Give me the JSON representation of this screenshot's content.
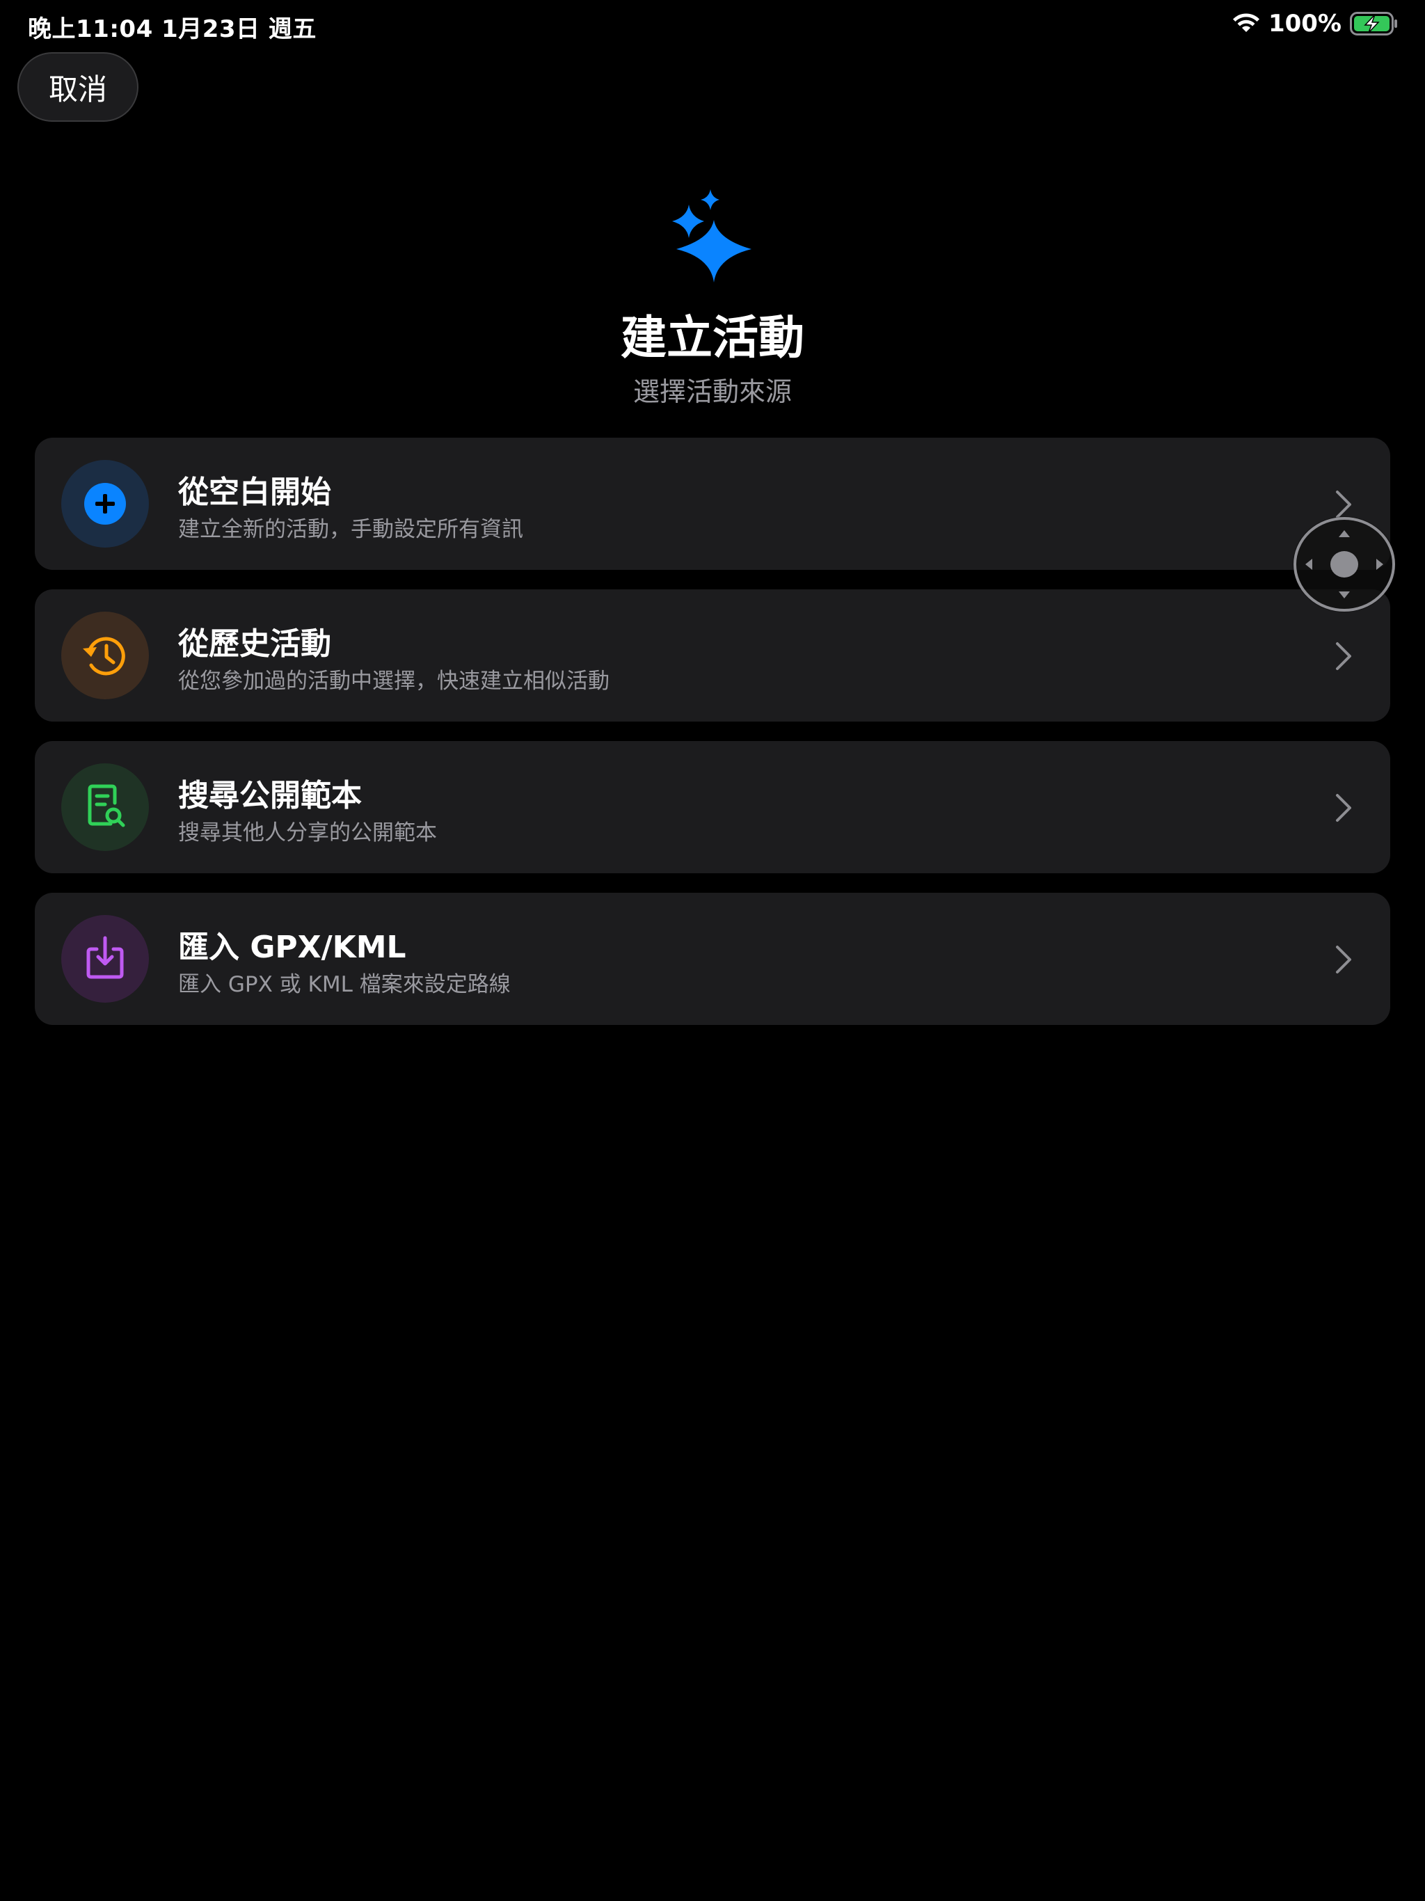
{
  "status_bar": {
    "time_date": "晚上11:04   1月23日 週五",
    "battery_percent": "100%",
    "battery_level": 1.0,
    "battery_color": "#34c759"
  },
  "header": {
    "cancel_label": "取消",
    "icon": "sparkles-icon",
    "icon_color": "#0a84ff",
    "title": "建立活動",
    "subtitle": "選擇活動來源"
  },
  "options": [
    {
      "title": "從空白開始",
      "description": "建立全新的活動，手動設定所有資訊",
      "icon": "plus-circle-icon",
      "accent": "#0a84ff"
    },
    {
      "title": "從歷史活動",
      "description": "從您參加過的活動中選擇，快速建立相似活動",
      "icon": "history-clock-icon",
      "accent": "#ff9f0a"
    },
    {
      "title": "搜尋公開範本",
      "description": "搜尋其他人分享的公開範本",
      "icon": "document-search-icon",
      "accent": "#30d158"
    },
    {
      "title": "匯入 GPX/KML",
      "description": "匯入 GPX 或 KML 檔案來設定路線",
      "icon": "import-tray-icon",
      "accent": "#bf5af2"
    }
  ]
}
